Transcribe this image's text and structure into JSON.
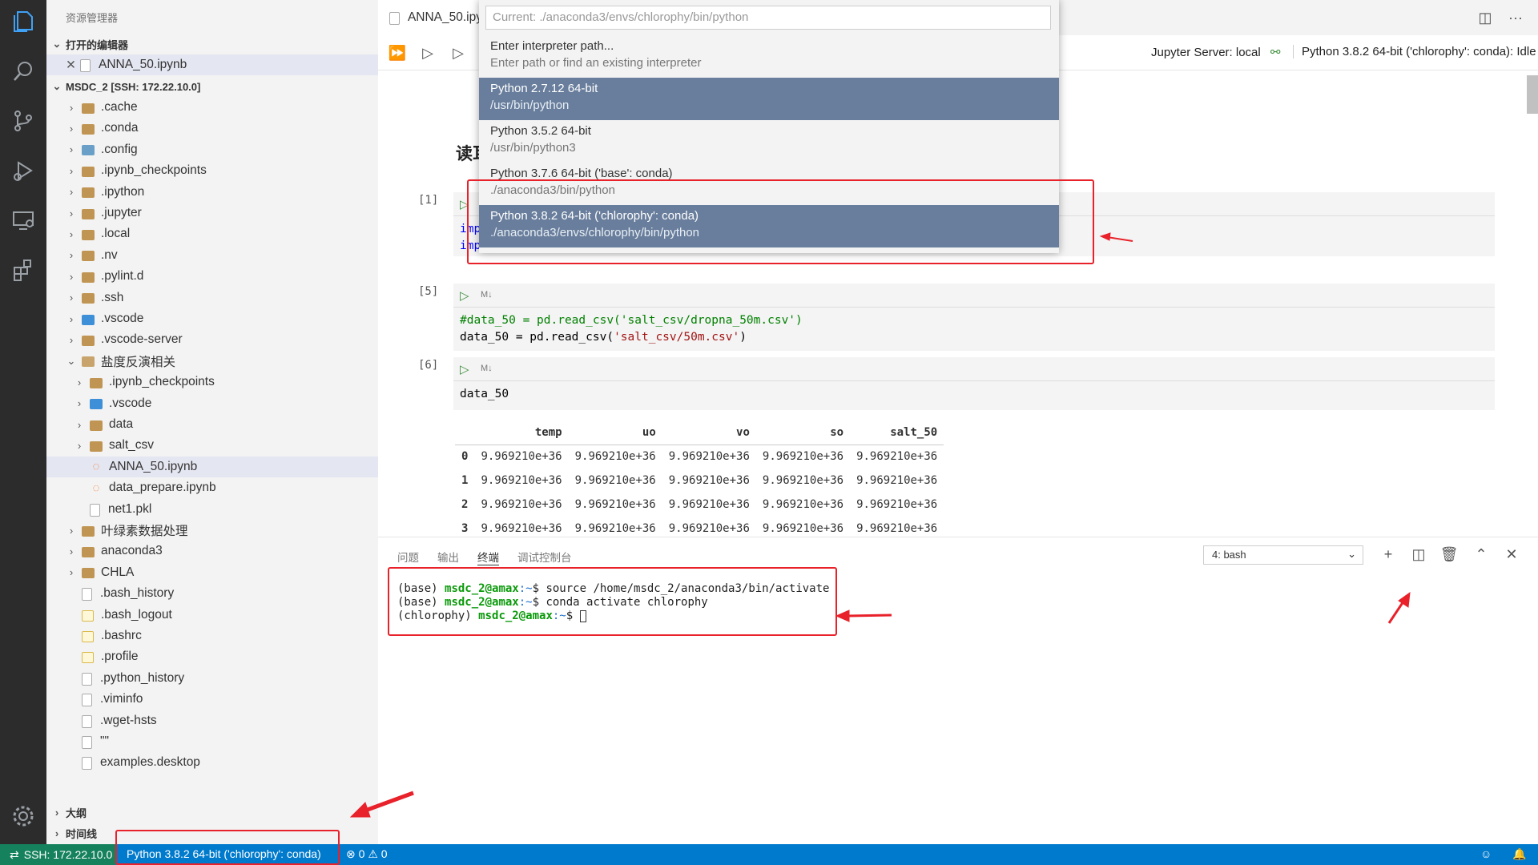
{
  "explorer": {
    "title": "资源管理器",
    "open_editors_header": "打开的编辑器",
    "open_editor_file": "ANNA_50.ipynb",
    "workspace_header": "MSDC_2 [SSH: 172.22.10.0]",
    "items": [
      {
        "label": ".cache",
        "type": "folder"
      },
      {
        "label": ".conda",
        "type": "folder"
      },
      {
        "label": ".config",
        "type": "folder-config"
      },
      {
        "label": ".ipynb_checkpoints",
        "type": "folder"
      },
      {
        "label": ".ipython",
        "type": "folder"
      },
      {
        "label": ".jupyter",
        "type": "folder"
      },
      {
        "label": ".local",
        "type": "folder"
      },
      {
        "label": ".nv",
        "type": "folder"
      },
      {
        "label": ".pylint.d",
        "type": "folder"
      },
      {
        "label": ".ssh",
        "type": "folder"
      },
      {
        "label": ".vscode",
        "type": "folder-blue"
      },
      {
        "label": ".vscode-server",
        "type": "folder"
      },
      {
        "label": "盐度反演相关",
        "type": "folder-open"
      },
      {
        "label": ".ipynb_checkpoints",
        "type": "folder"
      },
      {
        "label": ".vscode",
        "type": "folder-blue"
      },
      {
        "label": "data",
        "type": "folder"
      },
      {
        "label": "salt_csv",
        "type": "folder"
      },
      {
        "label": "ANNA_50.ipynb",
        "type": "notebook"
      },
      {
        "label": "data_prepare.ipynb",
        "type": "notebook"
      },
      {
        "label": "net1.pkl",
        "type": "file"
      },
      {
        "label": "叶绿素数据处理",
        "type": "folder"
      },
      {
        "label": "anaconda3",
        "type": "folder"
      },
      {
        "label": "CHLA",
        "type": "folder"
      },
      {
        "label": ".bash_history",
        "type": "file"
      },
      {
        "label": ".bash_logout",
        "type": "shell"
      },
      {
        "label": ".bashrc",
        "type": "shell"
      },
      {
        "label": ".profile",
        "type": "shell"
      },
      {
        "label": ".python_history",
        "type": "file"
      },
      {
        "label": ".viminfo",
        "type": "file"
      },
      {
        "label": ".wget-hsts",
        "type": "file"
      },
      {
        "label": "\"\"",
        "type": "file"
      },
      {
        "label": "examples.desktop",
        "type": "file"
      }
    ],
    "outline_header": "大纲",
    "timeline_header": "时间线"
  },
  "editor": {
    "tab_label": "ANNA_50.ipy",
    "jupyter_server": "Jupyter Server: local",
    "kernel_status": "Python 3.8.2 64-bit ('chlorophy': conda): Idle",
    "heading_partial": "读耳",
    "cells": [
      {
        "num": "[1]",
        "code_partial": [
          "imp",
          "imp"
        ]
      },
      {
        "num": "[5]",
        "md_tag": "M↓",
        "line1_comment": "#data_50 = pd.read_csv(",
        "line1_str": "'salt_csv/dropna_50m.csv'",
        "line1_end": ")",
        "line2_pre": "data_50 = pd.read_csv(",
        "line2_str": "'salt_csv/50m.csv'",
        "line2_end": ")"
      },
      {
        "num": "[6]",
        "md_tag": "M↓",
        "code": "data_50"
      }
    ],
    "dataframe": {
      "columns": [
        "",
        "temp",
        "uo",
        "vo",
        "so",
        "salt_50"
      ],
      "rows": [
        [
          "0",
          "9.969210e+36",
          "9.969210e+36",
          "9.969210e+36",
          "9.969210e+36",
          "9.969210e+36"
        ],
        [
          "1",
          "9.969210e+36",
          "9.969210e+36",
          "9.969210e+36",
          "9.969210e+36",
          "9.969210e+36"
        ],
        [
          "2",
          "9.969210e+36",
          "9.969210e+36",
          "9.969210e+36",
          "9.969210e+36",
          "9.969210e+36"
        ],
        [
          "3",
          "9.969210e+36",
          "9.969210e+36",
          "9.969210e+36",
          "9.969210e+36",
          "9.969210e+36"
        ]
      ]
    }
  },
  "quickpick": {
    "placeholder": "Current: ./anaconda3/envs/chlorophy/bin/python",
    "items": [
      {
        "title": "Enter interpreter path...",
        "sub": "Enter path or find an existing interpreter"
      },
      {
        "title": "Python 2.7.12 64-bit",
        "sub": "/usr/bin/python"
      },
      {
        "title": "Python 3.5.2 64-bit",
        "sub": "/usr/bin/python3"
      },
      {
        "title": "Python 3.7.6 64-bit ('base': conda)",
        "sub": "./anaconda3/bin/python"
      },
      {
        "title": "Python 3.8.2 64-bit ('chlorophy': conda)",
        "sub": "./anaconda3/envs/chlorophy/bin/python"
      }
    ]
  },
  "panel": {
    "tabs": [
      "问题",
      "输出",
      "终端",
      "调试控制台"
    ],
    "terminal_select": "4: bash",
    "terminal": [
      {
        "env": "(base) ",
        "user": "msdc_2@amax",
        "path": ":~",
        "cmd": "$ source /home/msdc_2/anaconda3/bin/activate"
      },
      {
        "env": "(base) ",
        "user": "msdc_2@amax",
        "path": ":~",
        "cmd": "$ conda activate chlorophy"
      },
      {
        "env": "(chlorophy) ",
        "user": "msdc_2@amax",
        "path": ":~",
        "cmd": "$ "
      }
    ]
  },
  "statusbar": {
    "remote": "SSH: 172.22.10.0",
    "interpreter": "Python 3.8.2 64-bit ('chlorophy': conda)",
    "errors": "0",
    "warnings": "0"
  },
  "colors": {
    "activity_bg": "#2c2c2c",
    "status_bg": "#007acc",
    "remote_bg": "#16825d",
    "highlight": "#697e9c",
    "annotation_red": "#e8212a"
  }
}
